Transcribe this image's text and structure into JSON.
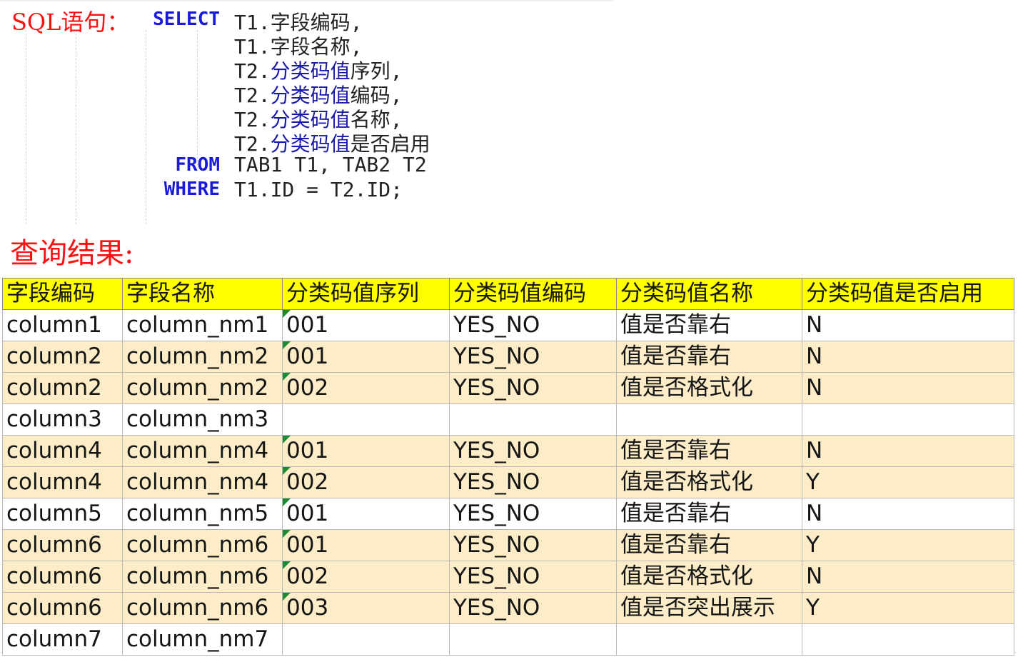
{
  "sql": {
    "label": "SQL语句：",
    "keywords": {
      "select": "SELECT",
      "from": "FROM",
      "where": "WHERE"
    },
    "select_lines": [
      {
        "pre": "T1.",
        "mid": "",
        "post": "字段编码,"
      },
      {
        "pre": "T1.",
        "mid": "",
        "post": "字段名称,"
      },
      {
        "pre": "T2.",
        "mid": "分类码值",
        "post": "序列,"
      },
      {
        "pre": "T2.",
        "mid": "分类码值",
        "post": "编码,"
      },
      {
        "pre": "T2.",
        "mid": "分类码值",
        "post": "名称,"
      },
      {
        "pre": "T2.",
        "mid": "分类码值",
        "post": "是否启用"
      }
    ],
    "from_clause": "TAB1 T1, TAB2 T2",
    "where_clause": "T1.ID = T2.ID;"
  },
  "result": {
    "label": "查询结果:",
    "columns": [
      "字段编码",
      "字段名称",
      "分类码值序列",
      "分类码值编码",
      "分类码值名称",
      "分类码值是否启用"
    ],
    "rows": [
      [
        "column1",
        "column_nm1",
        "001",
        "YES_NO",
        "值是否靠右",
        "N"
      ],
      [
        "column2",
        "column_nm2",
        "001",
        "YES_NO",
        "值是否靠右",
        "N"
      ],
      [
        "column2",
        "column_nm2",
        "002",
        "YES_NO",
        "值是否格式化",
        "N"
      ],
      [
        "column3",
        "column_nm3",
        "",
        "",
        "",
        ""
      ],
      [
        "column4",
        "column_nm4",
        "001",
        "YES_NO",
        "值是否靠右",
        "N"
      ],
      [
        "column4",
        "column_nm4",
        "002",
        "YES_NO",
        "值是否格式化",
        "Y"
      ],
      [
        "column5",
        "column_nm5",
        "001",
        "YES_NO",
        "值是否靠右",
        "N"
      ],
      [
        "column6",
        "column_nm6",
        "001",
        "YES_NO",
        "值是否靠右",
        "Y"
      ],
      [
        "column6",
        "column_nm6",
        "002",
        "YES_NO",
        "值是否格式化",
        "N"
      ],
      [
        "column6",
        "column_nm6",
        "003",
        "YES_NO",
        "值是否突出展示",
        "Y"
      ],
      [
        "column7",
        "column_nm7",
        "",
        "",
        "",
        ""
      ]
    ],
    "row_shading": [
      "odd",
      "even",
      "even",
      "odd",
      "even",
      "even",
      "odd",
      "even",
      "even",
      "even",
      "odd"
    ],
    "colors": {
      "header": "#ffff00",
      "shaded_row": "#fcedc8",
      "title_red": "#ff1010",
      "keyword_blue": "#1a1adc",
      "text_marker": "#1e8a34"
    }
  }
}
